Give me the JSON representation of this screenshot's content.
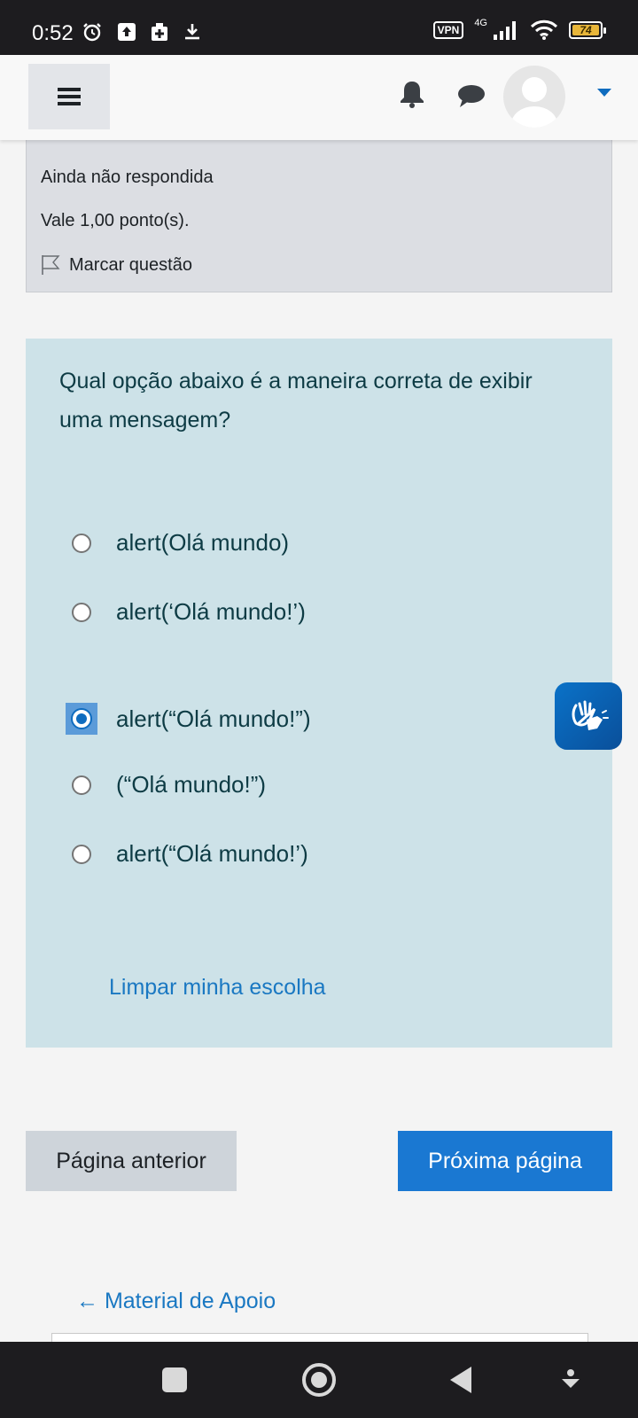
{
  "status_bar": {
    "time": "0:52",
    "vpn": "VPN",
    "network": "4G",
    "battery": "74"
  },
  "header": {
    "menu_icon": "hamburger-icon",
    "notification_icon": "bell-icon",
    "messages_icon": "chat-icon",
    "user_menu_icon": "caret-down-icon"
  },
  "question_info": {
    "status": "Ainda não respondida",
    "points": "Vale 1,00 ponto(s).",
    "flag_label": "Marcar questão"
  },
  "question": {
    "text": "Qual opção abaixo é a maneira correta de exibir uma mensagem?",
    "options": [
      {
        "label": "alert(Olá mundo)",
        "selected": false
      },
      {
        "label": "alert(‘Olá mundo!’)",
        "selected": false
      },
      {
        "label": "alert(“Olá mundo!”)",
        "selected": true
      },
      {
        "label": "(“Olá mundo!”)",
        "selected": false
      },
      {
        "label": "alert(“Olá mundo!’)",
        "selected": false
      }
    ],
    "clear_choice": "Limpar minha escolha"
  },
  "navigation": {
    "prev_label": "Página anterior",
    "next_label": "Próxima página",
    "material_link": "← Material de Apoio"
  },
  "colors": {
    "accent": "#0f6cbf",
    "question_bg": "#cde2e8",
    "info_bg": "#dcdee3",
    "next_button": "#1a78d2",
    "prev_button": "#ced4da"
  }
}
